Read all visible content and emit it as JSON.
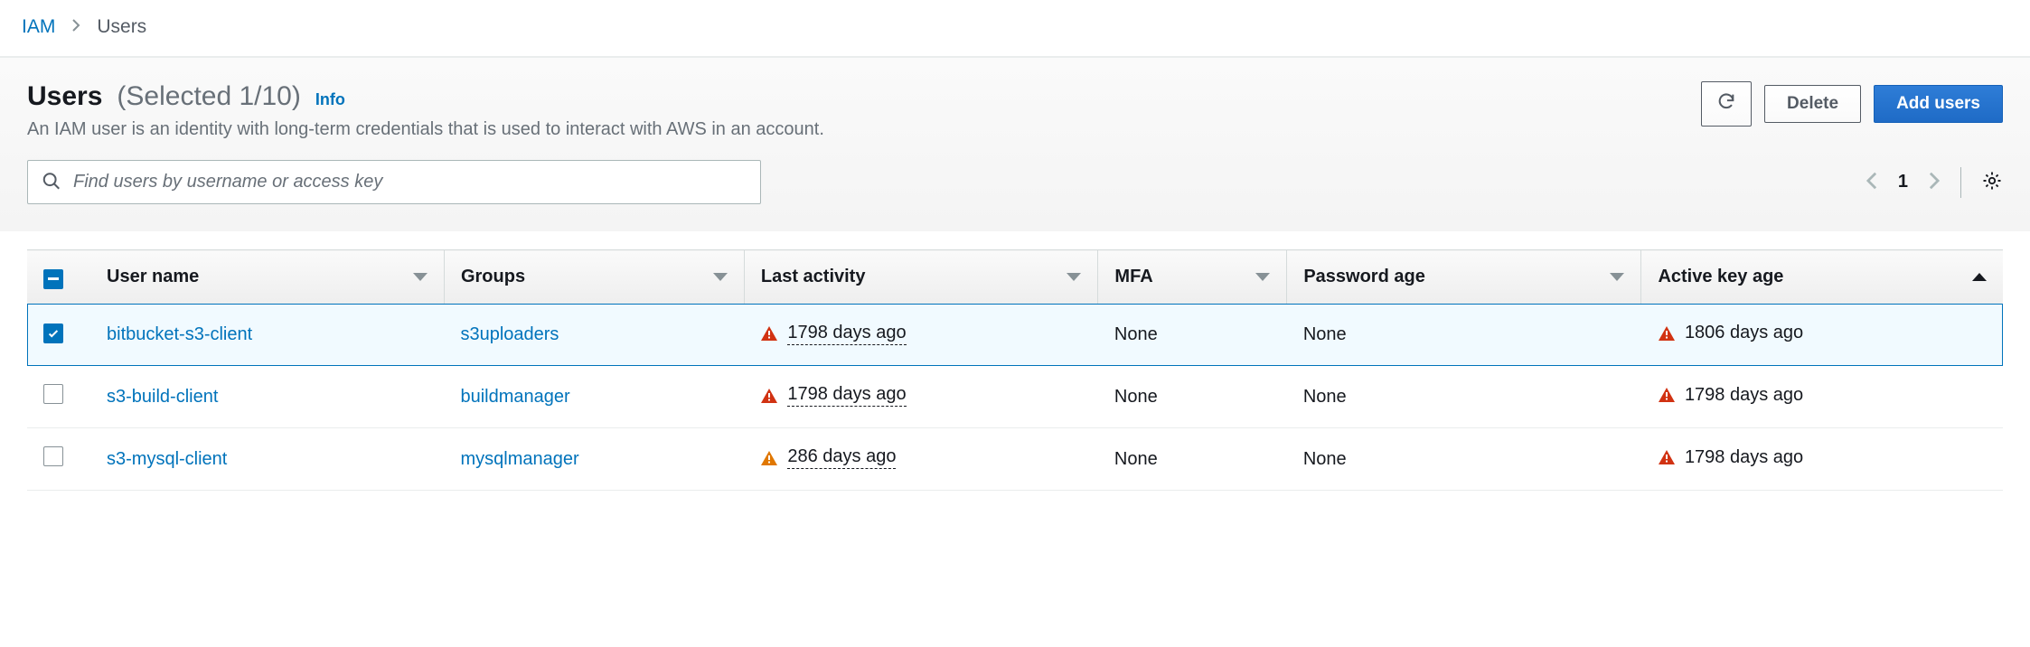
{
  "breadcrumb": {
    "root": "IAM",
    "current": "Users"
  },
  "header": {
    "title": "Users",
    "selected": "(Selected 1/10)",
    "info": "Info",
    "subtitle": "An IAM user is an identity with long-term credentials that is used to interact with AWS in an account."
  },
  "actions": {
    "refresh_aria": "Refresh",
    "delete": "Delete",
    "add": "Add users"
  },
  "search": {
    "placeholder": "Find users by username or access key"
  },
  "pagination": {
    "page": "1"
  },
  "columns": {
    "user_name": "User name",
    "groups": "Groups",
    "last_activity": "Last activity",
    "mfa": "MFA",
    "password_age": "Password age",
    "active_key_age": "Active key age"
  },
  "rows": [
    {
      "selected": true,
      "user_name": "bitbucket-s3-client",
      "groups": "s3uploaders",
      "last_activity": "1798 days ago",
      "last_activity_severity": "red",
      "mfa": "None",
      "password_age": "None",
      "active_key_age": "1806 days ago",
      "active_key_severity": "red"
    },
    {
      "selected": false,
      "user_name": "s3-build-client",
      "groups": "buildmanager",
      "last_activity": "1798 days ago",
      "last_activity_severity": "red",
      "mfa": "None",
      "password_age": "None",
      "active_key_age": "1798 days ago",
      "active_key_severity": "red"
    },
    {
      "selected": false,
      "user_name": "s3-mysql-client",
      "groups": "mysqlmanager",
      "last_activity": "286 days ago",
      "last_activity_severity": "orange",
      "mfa": "None",
      "password_age": "None",
      "active_key_age": "1798 days ago",
      "active_key_severity": "red"
    }
  ],
  "colors": {
    "red": "#d13212",
    "orange": "#e07700",
    "link": "#0073bb"
  }
}
